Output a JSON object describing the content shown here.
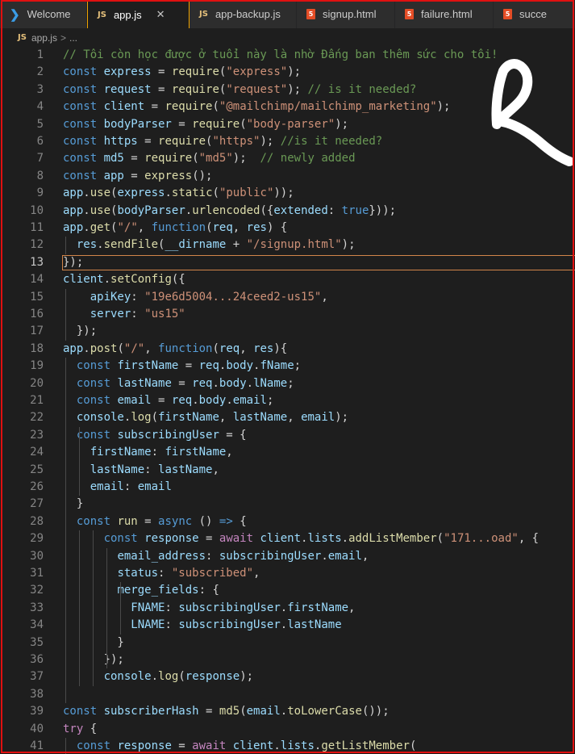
{
  "tabs": [
    {
      "label": "Welcome",
      "icon": "vscode-icon",
      "active": false
    },
    {
      "label": "app.js",
      "icon": "javascript-file-icon",
      "active": true
    },
    {
      "label": "app-backup.js",
      "icon": "javascript-file-icon",
      "active": false
    },
    {
      "label": "signup.html",
      "icon": "html-file-icon",
      "active": false
    },
    {
      "label": "failure.html",
      "icon": "html-file-icon",
      "active": false
    },
    {
      "label": "succe",
      "icon": "html-file-icon",
      "active": false
    }
  ],
  "breadcrumb": {
    "file": "app.js",
    "rest": "..."
  },
  "editor": {
    "current_line": 13,
    "line_numbers": [
      "1",
      "2",
      "3",
      "4",
      "5",
      "6",
      "7",
      "8",
      "9",
      "10",
      "11",
      "12",
      "13",
      "14",
      "15",
      "16",
      "17",
      "18",
      "19",
      "20",
      "21",
      "22",
      "23",
      "24",
      "25",
      "26",
      "27",
      "28",
      "29",
      "30",
      "31",
      "32",
      "33",
      "34",
      "35",
      "36",
      "37",
      "38",
      "39",
      "40",
      "41"
    ],
    "lines": [
      [
        [
          "c",
          "// Tôi còn học được ở tuổi này là nhờ Đấng ban thêm sức cho tôi!"
        ]
      ],
      [
        [
          "k",
          "const "
        ],
        [
          "v",
          "express"
        ],
        [
          "p",
          " = "
        ],
        [
          "f",
          "require"
        ],
        [
          "p",
          "("
        ],
        [
          "s",
          "\"express\""
        ],
        [
          "p",
          ");"
        ]
      ],
      [
        [
          "k",
          "const "
        ],
        [
          "v",
          "request"
        ],
        [
          "p",
          " = "
        ],
        [
          "f",
          "require"
        ],
        [
          "p",
          "("
        ],
        [
          "s",
          "\"request\""
        ],
        [
          "p",
          "); "
        ],
        [
          "c",
          "// is it needed?"
        ]
      ],
      [
        [
          "k",
          "const "
        ],
        [
          "v",
          "client"
        ],
        [
          "p",
          " = "
        ],
        [
          "f",
          "require"
        ],
        [
          "p",
          "("
        ],
        [
          "s",
          "\"@mailchimp/mailchimp_marketing\""
        ],
        [
          "p",
          ");"
        ]
      ],
      [
        [
          "k",
          "const "
        ],
        [
          "v",
          "bodyParser"
        ],
        [
          "p",
          " = "
        ],
        [
          "f",
          "require"
        ],
        [
          "p",
          "("
        ],
        [
          "s",
          "\"body-parser\""
        ],
        [
          "p",
          ");"
        ]
      ],
      [
        [
          "k",
          "const "
        ],
        [
          "v",
          "https"
        ],
        [
          "p",
          " = "
        ],
        [
          "f",
          "require"
        ],
        [
          "p",
          "("
        ],
        [
          "s",
          "\"https\""
        ],
        [
          "p",
          "); "
        ],
        [
          "c",
          "//is it needed?"
        ]
      ],
      [
        [
          "k",
          "const "
        ],
        [
          "v",
          "md5"
        ],
        [
          "p",
          " = "
        ],
        [
          "f",
          "require"
        ],
        [
          "p",
          "("
        ],
        [
          "s",
          "\"md5\""
        ],
        [
          "p",
          ");  "
        ],
        [
          "c",
          "// newly added"
        ]
      ],
      [
        [
          "k",
          "const "
        ],
        [
          "v",
          "app"
        ],
        [
          "p",
          " = "
        ],
        [
          "f",
          "express"
        ],
        [
          "p",
          "();"
        ]
      ],
      [
        [
          "v",
          "app"
        ],
        [
          "p",
          "."
        ],
        [
          "f",
          "use"
        ],
        [
          "p",
          "("
        ],
        [
          "v",
          "express"
        ],
        [
          "p",
          "."
        ],
        [
          "f",
          "static"
        ],
        [
          "p",
          "("
        ],
        [
          "s",
          "\"public\""
        ],
        [
          "p",
          "));"
        ]
      ],
      [
        [
          "v",
          "app"
        ],
        [
          "p",
          "."
        ],
        [
          "f",
          "use"
        ],
        [
          "p",
          "("
        ],
        [
          "v",
          "bodyParser"
        ],
        [
          "p",
          "."
        ],
        [
          "f",
          "urlencoded"
        ],
        [
          "p",
          "({"
        ],
        [
          "v",
          "extended"
        ],
        [
          "p",
          ": "
        ],
        [
          "k",
          "true"
        ],
        [
          "p",
          "}));"
        ]
      ],
      [
        [
          "v",
          "app"
        ],
        [
          "p",
          "."
        ],
        [
          "f",
          "get"
        ],
        [
          "p",
          "("
        ],
        [
          "s",
          "\"/\""
        ],
        [
          "p",
          ", "
        ],
        [
          "k",
          "function"
        ],
        [
          "p",
          "("
        ],
        [
          "v",
          "req"
        ],
        [
          "p",
          ", "
        ],
        [
          "v",
          "res"
        ],
        [
          "p",
          ") {"
        ]
      ],
      [
        [
          "p",
          "  "
        ],
        [
          "v",
          "res"
        ],
        [
          "p",
          "."
        ],
        [
          "f",
          "sendFile"
        ],
        [
          "p",
          "("
        ],
        [
          "v",
          "__dirname"
        ],
        [
          "p",
          " + "
        ],
        [
          "s",
          "\"/signup.html\""
        ],
        [
          "p",
          ");"
        ]
      ],
      [
        [
          "p",
          "});"
        ]
      ],
      [
        [
          "v",
          "client"
        ],
        [
          "p",
          "."
        ],
        [
          "f",
          "setConfig"
        ],
        [
          "p",
          "({"
        ]
      ],
      [
        [
          "p",
          "    "
        ],
        [
          "v",
          "apiKey"
        ],
        [
          "p",
          ": "
        ],
        [
          "s",
          "\"19e6d5004...24ceed2-us15\""
        ],
        [
          "p",
          ","
        ]
      ],
      [
        [
          "p",
          "    "
        ],
        [
          "v",
          "server"
        ],
        [
          "p",
          ": "
        ],
        [
          "s",
          "\"us15\""
        ]
      ],
      [
        [
          "p",
          "  });"
        ]
      ],
      [
        [
          "v",
          "app"
        ],
        [
          "p",
          "."
        ],
        [
          "f",
          "post"
        ],
        [
          "p",
          "("
        ],
        [
          "s",
          "\"/\""
        ],
        [
          "p",
          ", "
        ],
        [
          "k",
          "function"
        ],
        [
          "p",
          "("
        ],
        [
          "v",
          "req"
        ],
        [
          "p",
          ", "
        ],
        [
          "v",
          "res"
        ],
        [
          "p",
          "){"
        ]
      ],
      [
        [
          "p",
          "  "
        ],
        [
          "k",
          "const "
        ],
        [
          "v",
          "firstName"
        ],
        [
          "p",
          " = "
        ],
        [
          "v",
          "req"
        ],
        [
          "p",
          "."
        ],
        [
          "v",
          "body"
        ],
        [
          "p",
          "."
        ],
        [
          "v",
          "fName"
        ],
        [
          "p",
          ";"
        ]
      ],
      [
        [
          "p",
          "  "
        ],
        [
          "k",
          "const "
        ],
        [
          "v",
          "lastName"
        ],
        [
          "p",
          " = "
        ],
        [
          "v",
          "req"
        ],
        [
          "p",
          "."
        ],
        [
          "v",
          "body"
        ],
        [
          "p",
          "."
        ],
        [
          "v",
          "lName"
        ],
        [
          "p",
          ";"
        ]
      ],
      [
        [
          "p",
          "  "
        ],
        [
          "k",
          "const "
        ],
        [
          "v",
          "email"
        ],
        [
          "p",
          " = "
        ],
        [
          "v",
          "req"
        ],
        [
          "p",
          "."
        ],
        [
          "v",
          "body"
        ],
        [
          "p",
          "."
        ],
        [
          "v",
          "email"
        ],
        [
          "p",
          ";"
        ]
      ],
      [
        [
          "p",
          "  "
        ],
        [
          "v",
          "console"
        ],
        [
          "p",
          "."
        ],
        [
          "f",
          "log"
        ],
        [
          "p",
          "("
        ],
        [
          "v",
          "firstName"
        ],
        [
          "p",
          ", "
        ],
        [
          "v",
          "lastName"
        ],
        [
          "p",
          ", "
        ],
        [
          "v",
          "email"
        ],
        [
          "p",
          ");"
        ]
      ],
      [
        [
          "p",
          "  "
        ],
        [
          "k",
          "const "
        ],
        [
          "v",
          "subscribingUser"
        ],
        [
          "p",
          " = {"
        ]
      ],
      [
        [
          "p",
          "    "
        ],
        [
          "v",
          "firstName"
        ],
        [
          "p",
          ": "
        ],
        [
          "v",
          "firstName"
        ],
        [
          "p",
          ","
        ]
      ],
      [
        [
          "p",
          "    "
        ],
        [
          "v",
          "lastName"
        ],
        [
          "p",
          ": "
        ],
        [
          "v",
          "lastName"
        ],
        [
          "p",
          ","
        ]
      ],
      [
        [
          "p",
          "    "
        ],
        [
          "v",
          "email"
        ],
        [
          "p",
          ": "
        ],
        [
          "v",
          "email"
        ]
      ],
      [
        [
          "p",
          "  }"
        ]
      ],
      [
        [
          "p",
          "  "
        ],
        [
          "k",
          "const "
        ],
        [
          "f",
          "run"
        ],
        [
          "p",
          " = "
        ],
        [
          "k",
          "async"
        ],
        [
          "p",
          " () "
        ],
        [
          "k",
          "=>"
        ],
        [
          "p",
          " {"
        ]
      ],
      [
        [
          "p",
          "      "
        ],
        [
          "k",
          "const "
        ],
        [
          "v",
          "response"
        ],
        [
          "p",
          " = "
        ],
        [
          "kc",
          "await "
        ],
        [
          "v",
          "client"
        ],
        [
          "p",
          "."
        ],
        [
          "v",
          "lists"
        ],
        [
          "p",
          "."
        ],
        [
          "f",
          "addListMember"
        ],
        [
          "p",
          "("
        ],
        [
          "s",
          "\"171...oad\""
        ],
        [
          "p",
          ", {"
        ]
      ],
      [
        [
          "p",
          "        "
        ],
        [
          "v",
          "email_address"
        ],
        [
          "p",
          ": "
        ],
        [
          "v",
          "subscribingUser"
        ],
        [
          "p",
          "."
        ],
        [
          "v",
          "email"
        ],
        [
          "p",
          ","
        ]
      ],
      [
        [
          "p",
          "        "
        ],
        [
          "v",
          "status"
        ],
        [
          "p",
          ": "
        ],
        [
          "s",
          "\"subscribed\""
        ],
        [
          "p",
          ","
        ]
      ],
      [
        [
          "p",
          "        "
        ],
        [
          "v",
          "merge_fields"
        ],
        [
          "p",
          ": {"
        ]
      ],
      [
        [
          "p",
          "          "
        ],
        [
          "v",
          "FNAME"
        ],
        [
          "p",
          ": "
        ],
        [
          "v",
          "subscribingUser"
        ],
        [
          "p",
          "."
        ],
        [
          "v",
          "firstName"
        ],
        [
          "p",
          ","
        ]
      ],
      [
        [
          "p",
          "          "
        ],
        [
          "v",
          "LNAME"
        ],
        [
          "p",
          ": "
        ],
        [
          "v",
          "subscribingUser"
        ],
        [
          "p",
          "."
        ],
        [
          "v",
          "lastName"
        ]
      ],
      [
        [
          "p",
          "        }"
        ]
      ],
      [
        [
          "p",
          "      });"
        ]
      ],
      [
        [
          "p",
          "      "
        ],
        [
          "v",
          "console"
        ],
        [
          "p",
          "."
        ],
        [
          "f",
          "log"
        ],
        [
          "p",
          "("
        ],
        [
          "v",
          "response"
        ],
        [
          "p",
          ");"
        ]
      ],
      [],
      [
        [
          "k",
          "const "
        ],
        [
          "v",
          "subscriberHash"
        ],
        [
          "p",
          " = "
        ],
        [
          "f",
          "md5"
        ],
        [
          "p",
          "("
        ],
        [
          "v",
          "email"
        ],
        [
          "p",
          "."
        ],
        [
          "f",
          "toLowerCase"
        ],
        [
          "p",
          "());"
        ]
      ],
      [
        [
          "kc",
          "try"
        ],
        [
          "p",
          " {"
        ]
      ],
      [
        [
          "p",
          "  "
        ],
        [
          "k",
          "const "
        ],
        [
          "v",
          "response"
        ],
        [
          "p",
          " = "
        ],
        [
          "kc",
          "await "
        ],
        [
          "v",
          "client"
        ],
        [
          "p",
          "."
        ],
        [
          "v",
          "lists"
        ],
        [
          "p",
          "."
        ],
        [
          "f",
          "getListMember"
        ],
        [
          "p",
          "("
        ]
      ]
    ]
  },
  "colors": {
    "annotation_border": "#e01010",
    "current_line_border": "#d1854a",
    "background": "#1e1e1e"
  },
  "annotation": {
    "hand_drawn_letter": "R"
  }
}
